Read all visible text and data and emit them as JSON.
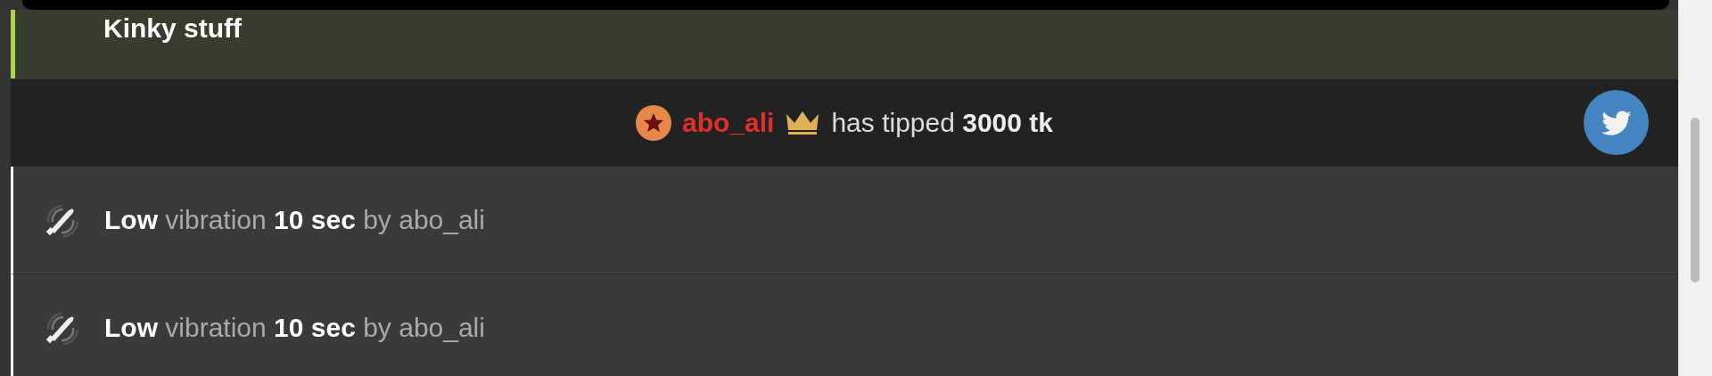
{
  "chat_messages": [
    {
      "kind": "notice",
      "text": "Kinky stuff"
    },
    {
      "kind": "tip",
      "username": "abo_ali",
      "text": "has tipped **3000 tk**"
    },
    {
      "kind": "vibration",
      "text": "**Low** vibration **10 sec** by abo_ali"
    },
    {
      "kind": "vibration",
      "text": "**Low** vibration **10 sec** by abo_ali"
    }
  ]
}
